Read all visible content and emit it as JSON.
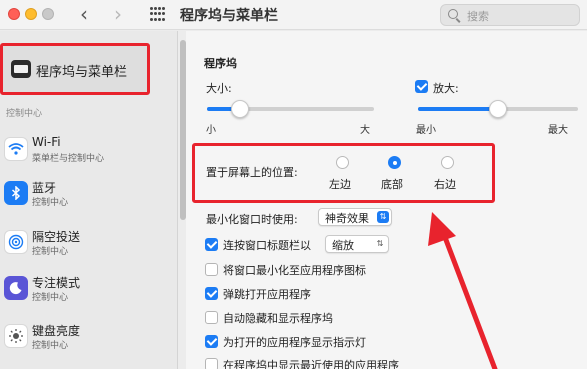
{
  "window": {
    "title": "程序坞与菜单栏",
    "search_placeholder": "搜索"
  },
  "sidebar": {
    "selected": {
      "label": "程序坞与菜单栏",
      "icon": "dock-icon"
    },
    "section_label": "控制中心",
    "items": [
      {
        "name": "Wi-Fi",
        "sub": "菜单栏与控制中心",
        "icon": "wifi-icon"
      },
      {
        "name": "蓝牙",
        "sub": "控制中心",
        "icon": "bluetooth-icon"
      },
      {
        "name": "隔空投送",
        "sub": "控制中心",
        "icon": "airdrop-icon"
      },
      {
        "name": "专注模式",
        "sub": "控制中心",
        "icon": "focus-moon-icon"
      },
      {
        "name": "键盘亮度",
        "sub": "控制中心",
        "icon": "keyboard-brightness-icon"
      }
    ]
  },
  "dock": {
    "section_title": "程序坞",
    "size": {
      "label": "大小:",
      "min": "小",
      "max": "大",
      "value": 0.2
    },
    "magnify": {
      "label": "放大:",
      "checked": true,
      "min": "最小",
      "max": "最大",
      "value": 0.5
    },
    "position": {
      "label": "置于屏幕上的位置:",
      "options": [
        {
          "label": "左边",
          "selected": false
        },
        {
          "label": "底部",
          "selected": true
        },
        {
          "label": "右边",
          "selected": false
        }
      ]
    },
    "minimize_effect": {
      "label": "最小化窗口时使用:",
      "value": "神奇效果"
    },
    "double_click": {
      "label": "连按窗口标题栏以",
      "value": "缩放",
      "checked": true
    },
    "options": [
      {
        "label": "将窗口最小化至应用程序图标",
        "checked": false
      },
      {
        "label": "弹跳打开应用程序",
        "checked": true
      },
      {
        "label": "自动隐藏和显示程序坞",
        "checked": false
      },
      {
        "label": "为打开的应用程序显示指示灯",
        "checked": true
      },
      {
        "label": "在程序坞中显示最近使用的应用程序",
        "checked": false
      }
    ]
  },
  "colors": {
    "accent": "#1c7cf4",
    "highlight": "#e8232d"
  }
}
